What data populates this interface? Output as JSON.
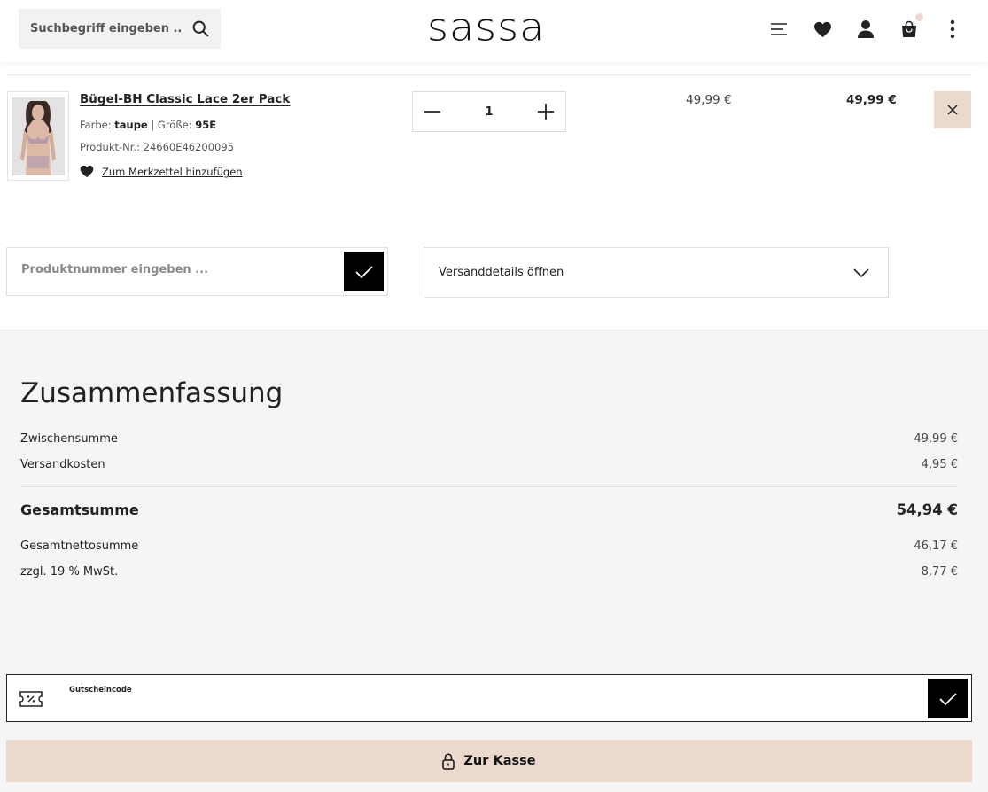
{
  "header": {
    "search_placeholder": "Suchbegriff eingeben ...",
    "logo": "sassa",
    "icons": [
      "search-icon",
      "menu-icon",
      "heart-icon",
      "user-icon",
      "cart-icon",
      "more-icon"
    ]
  },
  "cart_item": {
    "name": "Bügel-BH Classic Lace 2er Pack",
    "color_label": "Farbe:",
    "color": "taupe",
    "separator": "|",
    "size_label": "Größe:",
    "size": "95E",
    "product_nr_label": "Produkt-Nr.:",
    "product_nr": "24660E46200095",
    "wishlist_label": "Zum Merkzettel hinzufügen",
    "quantity": "1",
    "unit_price": "49,99 €",
    "total_price": "49,99 €"
  },
  "product_input": {
    "placeholder": "Produktnummer eingeben ..."
  },
  "shipping": {
    "label": "Versanddetails öffnen"
  },
  "summary": {
    "title": "Zusammenfassung",
    "subtotal_label": "Zwischensumme",
    "subtotal": "49,99 €",
    "shipping_label": "Versandkosten",
    "shipping": "4,95 €",
    "total_label": "Gesamtsumme",
    "total": "54,94 €",
    "net_label": "Gesamtnettosumme",
    "net": "46,17 €",
    "vat_label": "zzgl. 19 % MwSt.",
    "vat": "8,77 €"
  },
  "voucher": {
    "label": "Gutscheincode"
  },
  "checkout": {
    "label": "Zur Kasse"
  },
  "colors": {
    "accent": "#ead9cc",
    "black": "#000000",
    "summary_bg": "#f5f5f5"
  }
}
